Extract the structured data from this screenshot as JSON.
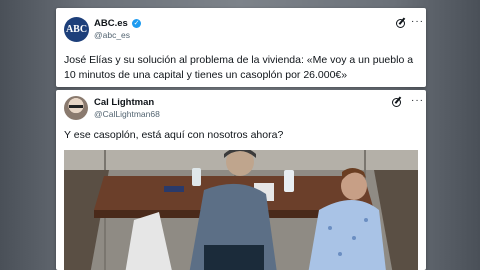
{
  "tweet1": {
    "avatar_text": "ABC",
    "name": "ABC.es",
    "handle": "@abc_es",
    "text": "José Elías y su solución al problema de la vivienda: «Me voy a un pueblo a 10 minutos de una capital y tienes un casoplón por 26.000€»",
    "verified_icon": "✓",
    "more_icon": "···"
  },
  "tweet2": {
    "name": "Cal Lightman",
    "handle": "@CalLightman68",
    "text": "Y ese casoplón, está aquí con nosotros ahora?",
    "more_icon": "···"
  },
  "colors": {
    "verified": "#1d9bf0",
    "abc_brand": "#1d3f7a"
  }
}
